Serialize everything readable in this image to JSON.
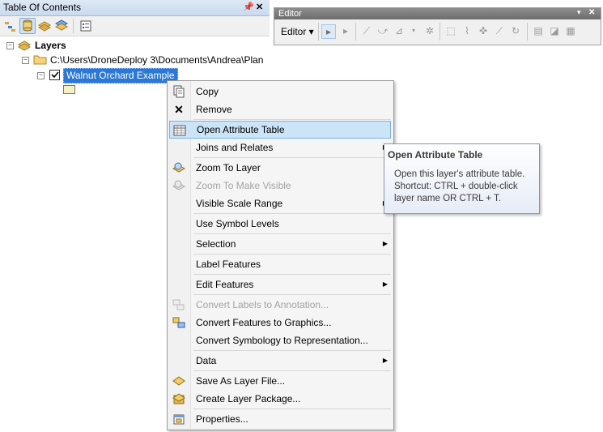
{
  "toc": {
    "title": "Table Of Contents",
    "pin_glyph": "📌",
    "close_glyph": "✕",
    "layers_label": "Layers",
    "folder_path": "C:\\Users\\DroneDeploy 3\\Documents\\Andrea\\Plan",
    "layer_name": "Walnut Orchard Example"
  },
  "editor": {
    "title": "Editor",
    "menu_label": "Editor ▾",
    "close_glyph": "✕"
  },
  "context_menu": {
    "items": [
      {
        "label": "Copy"
      },
      {
        "label": "Remove"
      },
      {
        "label": "Open Attribute Table"
      },
      {
        "label": "Joins and Relates"
      },
      {
        "label": "Zoom To Layer"
      },
      {
        "label": "Zoom To Make Visible"
      },
      {
        "label": "Visible Scale Range"
      },
      {
        "label": "Use Symbol Levels"
      },
      {
        "label": "Selection"
      },
      {
        "label": "Label Features"
      },
      {
        "label": "Edit Features"
      },
      {
        "label": "Convert Labels to Annotation..."
      },
      {
        "label": "Convert Features to Graphics..."
      },
      {
        "label": "Convert Symbology to Representation..."
      },
      {
        "label": "Data"
      },
      {
        "label": "Save As Layer File..."
      },
      {
        "label": "Create Layer Package..."
      },
      {
        "label": "Properties..."
      }
    ]
  },
  "tooltip": {
    "title": "Open Attribute Table",
    "body": "Open this layer's attribute table. Shortcut: CTRL + double-click layer name OR CTRL + T."
  }
}
